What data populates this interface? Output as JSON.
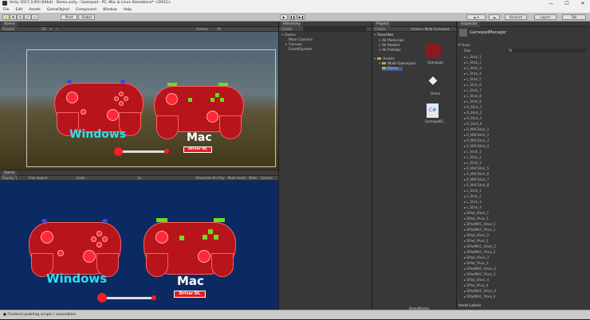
{
  "window": {
    "title": "Unity 2017.3.0f3 (64bit) - Demo.unity - Gamepad - PC, Mac & Linux Standalone* <DX11>",
    "minimize": "—",
    "maximize": "☐",
    "close": "✕"
  },
  "menu": [
    "File",
    "Edit",
    "Assets",
    "GameObject",
    "Component",
    "Window",
    "Help"
  ],
  "toolbar": {
    "pivot": "Pivot",
    "global": "Global",
    "account": "Account",
    "layers": "Layers",
    "layout": "Layout",
    "layout_value": "Tall"
  },
  "scene": {
    "tab": "Scene",
    "shaded": "Shaded",
    "mode_2d": "2D",
    "gizmos": "Gizmos",
    "search_all": "All"
  },
  "game": {
    "tab": "Game",
    "display": "Display 1",
    "aspect": "Free Aspect",
    "scale_label": "Scale",
    "scale": "1x",
    "maximize": "Maximize On Play",
    "mute": "Mute Audio",
    "stats": "Stats",
    "gizmos": "Gizmos"
  },
  "controllers": {
    "windows_label": "Windows",
    "mac_label": "Mac",
    "driver_button": "Driver DL",
    "colors": {
      "body": "#b8141c",
      "outline": "#ff6060",
      "label_cyan": "#35dde8",
      "label_white": "#ffffff",
      "game_bg": "#0b2a63"
    }
  },
  "hierarchy": {
    "tab": "Hierarchy",
    "create": "Create",
    "scene_name": "Demo",
    "items": [
      "Main Camera",
      "Canvas",
      "EventSystem"
    ]
  },
  "project": {
    "tab": "Project",
    "create": "Create",
    "breadcrumb": "Assets ▸ Multi-Gamepad",
    "favorites": "Favorites",
    "favorite_items": [
      "All Materials",
      "All Models",
      "All Prefabs"
    ],
    "assets_root": "Assets",
    "asset_folders": [
      "Multi-Gamepad",
      "Demo"
    ],
    "files": [
      {
        "name": "Gamepad",
        "kind": "prefab"
      },
      {
        "name": "Demo",
        "kind": "unity"
      },
      {
        "name": "GamepadD...",
        "kind": "script"
      }
    ],
    "footer_file": "DemoMaster"
  },
  "inspector": {
    "tab": "Inspector",
    "object_name": "GamepadManager",
    "section": "P Axes",
    "size_label": "Size",
    "size_value": "76",
    "items": [
      "L_Stick_1",
      "L_Stick_2",
      "L_Stick_3",
      "L_Stick_4",
      "L_Stick_5",
      "L_Stick_6",
      "L_Stick_7",
      "L_Stick_8",
      "L_Stick_9",
      "R_Stick_1",
      "R_Stick_2",
      "R_Stick_3",
      "R_Stick_4",
      "R_MACStick_1",
      "R_MACStick_2",
      "R_MACStick_3",
      "R_MACStick_4",
      "L_Stick_1",
      "L_Stick_2",
      "L_Stick_3",
      "R_MACStick_5",
      "R_MACStick_6",
      "R_MACStick_7",
      "R_MACStick_8",
      "L_Stick_1",
      "L_Stick_2",
      "L_Stick_3",
      "L_Stick_4",
      "DPad_XAxis_1",
      "DPad_YAxis_1",
      "DPadMAC_XAxis_1",
      "DPadMAC_YAxis_1",
      "DPad_XAxis_2",
      "DPad_YAxis_2",
      "DPadMAC_XAxis_2",
      "DPadMAC_YAxis_2",
      "DPad_XAxis_3",
      "DPad_YAxis_3",
      "DPadMAC_XAxis_3",
      "DPadMAC_YAxis_3",
      "DPad_XAxis_4",
      "DPad_YAxis_4",
      "DPadMAC_XAxis_4",
      "DPadMAC_YAxis_4"
    ],
    "footer": "Asset Labels"
  },
  "status": {
    "message": "Finished updating scripts / assemblies"
  }
}
